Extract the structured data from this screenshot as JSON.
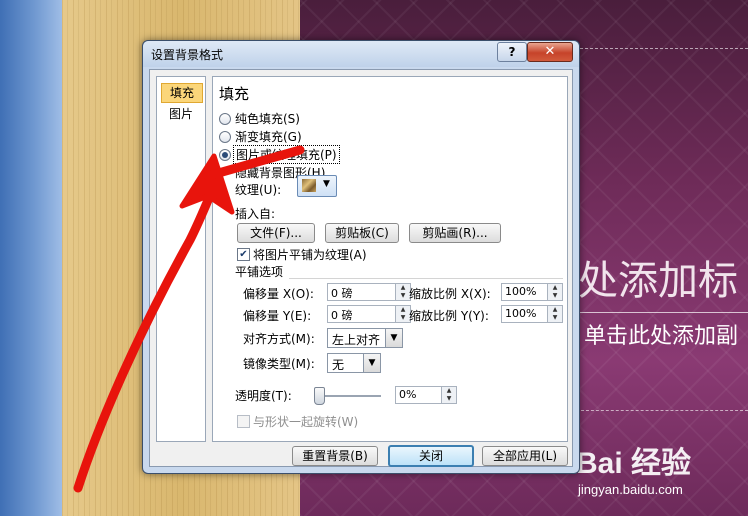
{
  "background": {
    "slide_title": "处添加标",
    "slide_subtitle": "单击此处添加副",
    "watermark": "Bai  经验",
    "watermark_url": "jingyan.baidu.com"
  },
  "dialog": {
    "title": "设置背景格式",
    "help_glyph": "?",
    "close_glyph": "✕",
    "nav": [
      "填充",
      "图片"
    ],
    "panel": {
      "heading": "填充",
      "radios": [
        "纯色填充(S)",
        "渐变填充(G)",
        "图片或纹理填充(P)"
      ],
      "hide_background": "隐藏背景图形(H)",
      "texture_label": "纹理(U):",
      "insert_from": "插入自:",
      "btn_file": "文件(F)...",
      "btn_clipboard": "剪贴板(C)",
      "btn_clipart": "剪贴画(R)...",
      "tile_checkbox": "将图片平铺为纹理(A)",
      "tile_options": "平铺选项",
      "offset_x_label": "偏移量 X(O):",
      "offset_x_value": "0 磅",
      "scale_x_label": "缩放比例 X(X):",
      "scale_x_value": "100%",
      "offset_y_label": "偏移量 Y(E):",
      "offset_y_value": "0 磅",
      "scale_y_label": "缩放比例 Y(Y):",
      "scale_y_value": "100%",
      "align_label": "对齐方式(M):",
      "align_value": "左上对齐",
      "mirror_label": "镜像类型(M):",
      "mirror_value": "无",
      "transparency_label": "透明度(T):",
      "transparency_value": "0%",
      "rotate_with_shape": "与形状一起旋转(W)"
    },
    "footer": {
      "reset": "重置背景(B)",
      "close": "关闭",
      "apply_all": "全部应用(L)"
    }
  },
  "colors": {
    "annotation_arrow": "#e8140c",
    "slide_bg": "#6e2b58",
    "dialog_frame": "#c9d9ee"
  }
}
